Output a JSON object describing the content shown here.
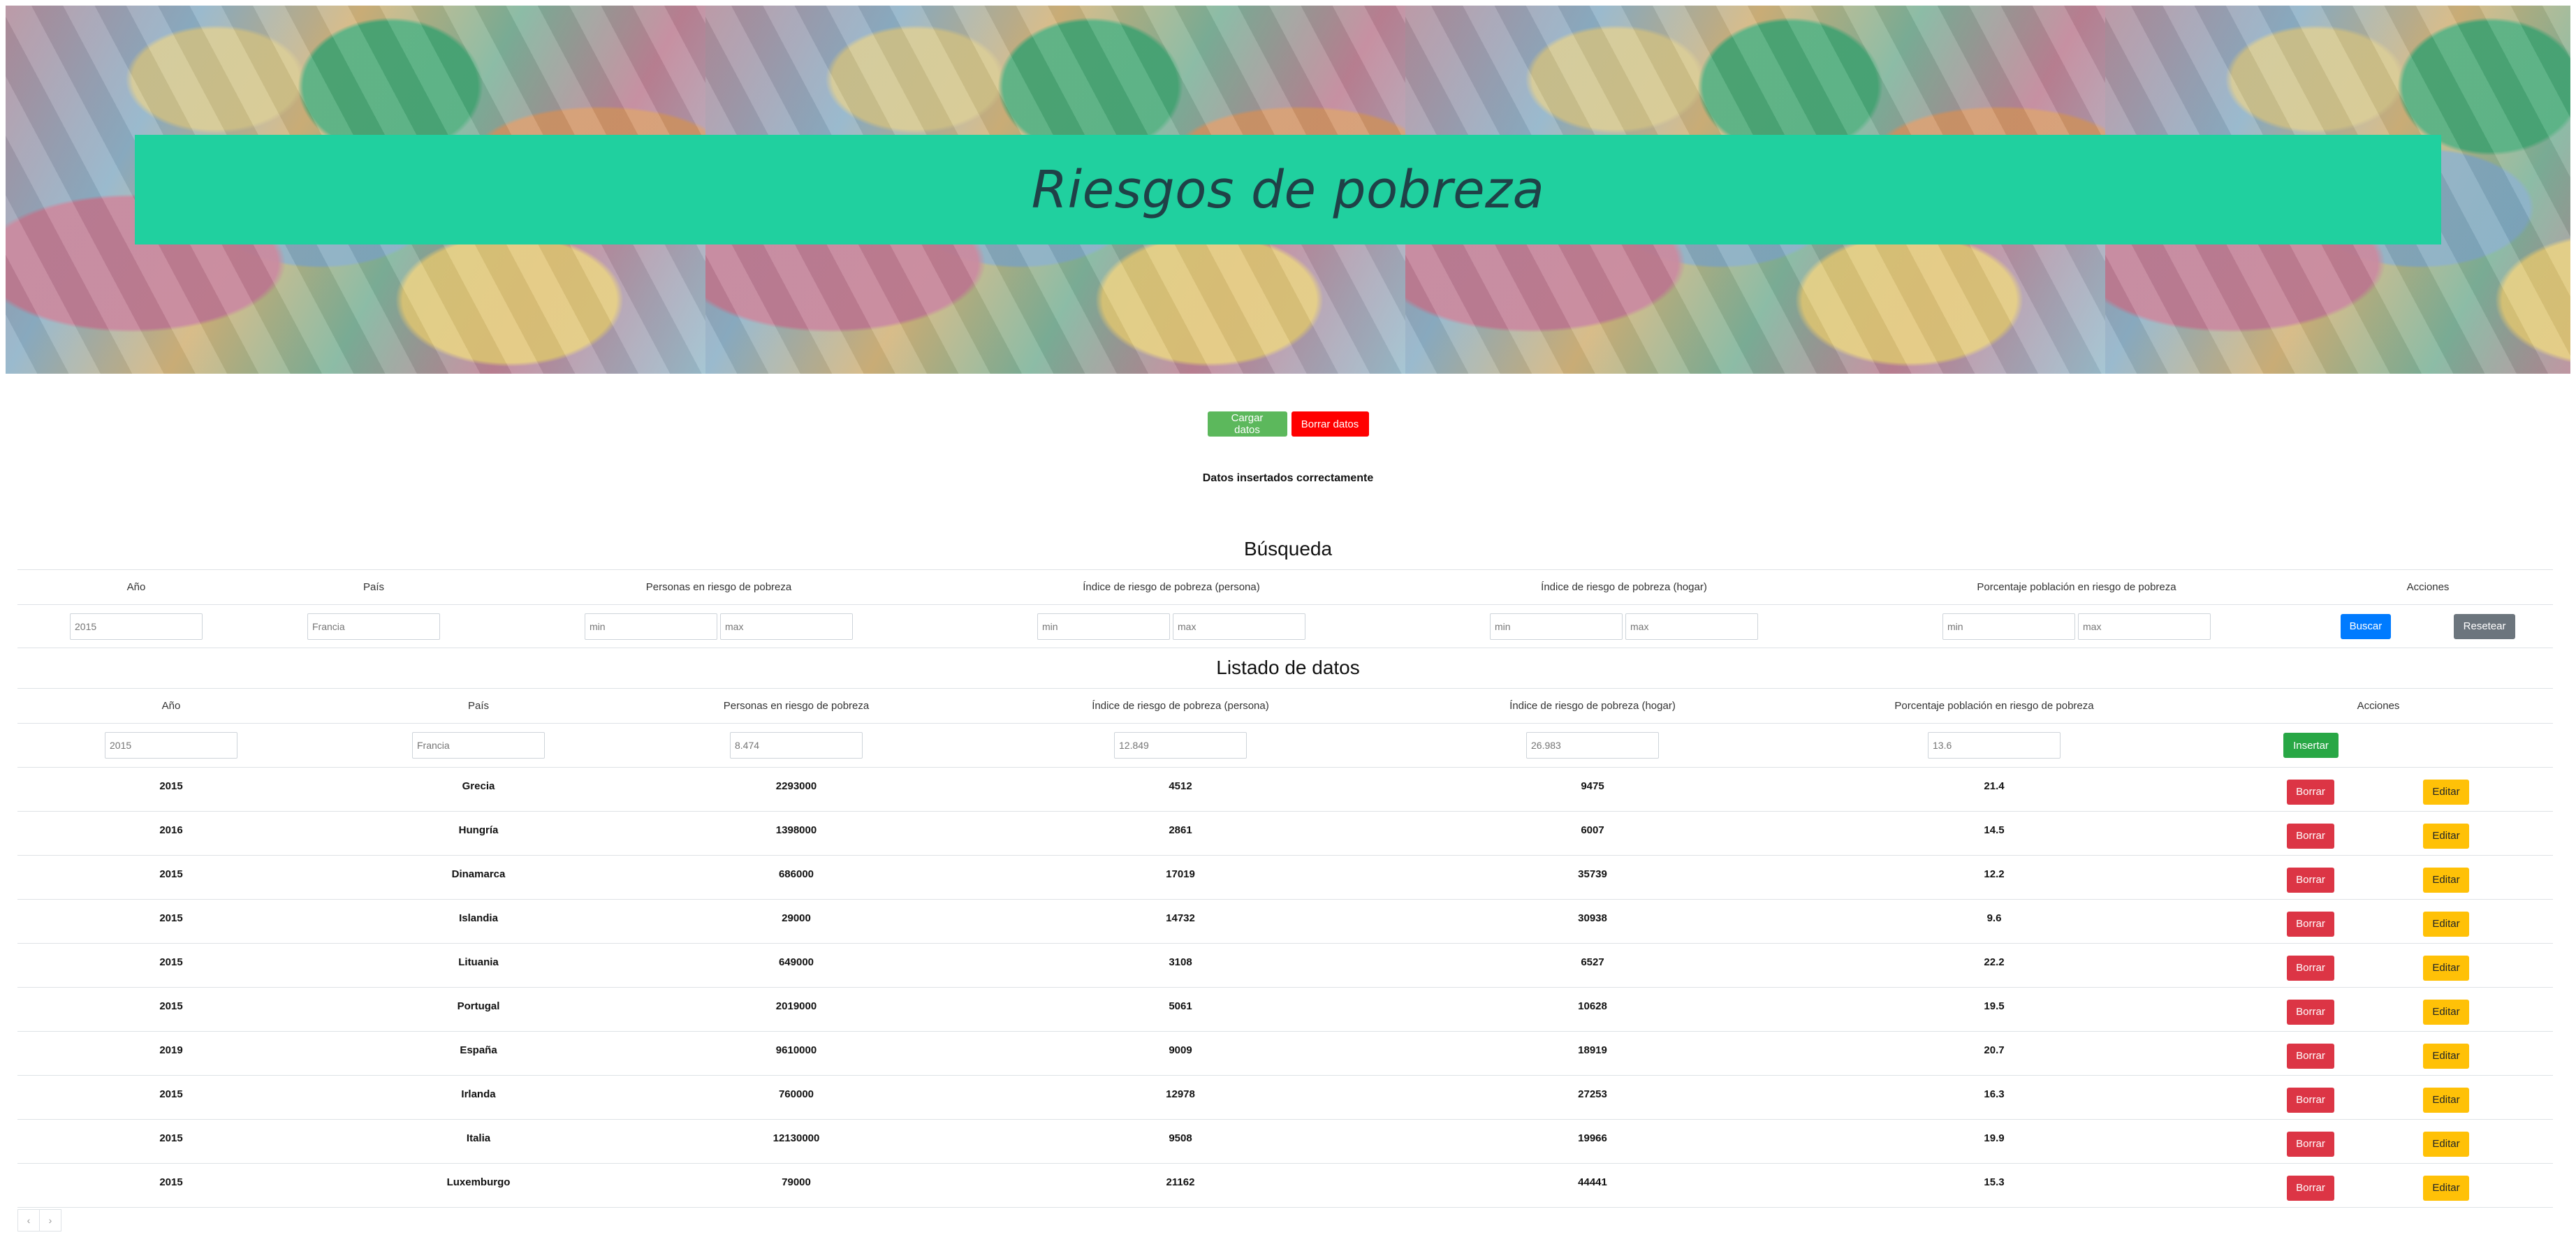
{
  "header": {
    "title": "Riesgos de pobreza"
  },
  "actions": {
    "load_label": "Cargar datos",
    "clear_label": "Borrar datos",
    "status_message": "Datos insertados correctamente"
  },
  "search": {
    "title": "Búsqueda",
    "columns": [
      "Año",
      "País",
      "Personas en riesgo de pobreza",
      "Índice de riesgo de pobreza (persona)",
      "Índice de riesgo de pobreza (hogar)",
      "Porcentaje población en riesgo de pobreza",
      "Acciones"
    ],
    "year_placeholder": "2015",
    "country_placeholder": "Francia",
    "min_placeholder": "min",
    "max_placeholder": "max",
    "search_label": "Buscar",
    "reset_label": "Resetear"
  },
  "list": {
    "title": "Listado de datos",
    "columns": [
      "Año",
      "País",
      "Personas en riesgo de pobreza",
      "Índice de riesgo de pobreza (persona)",
      "Índice de riesgo de pobreza (hogar)",
      "Porcentaje población en riesgo de pobreza",
      "Acciones"
    ],
    "new_row_placeholders": {
      "year": "2015",
      "country": "Francia",
      "people": "8.474",
      "index_person": "12.849",
      "index_home": "26.983",
      "percentage": "13.6"
    },
    "insert_label": "Insertar",
    "delete_label": "Borrar",
    "edit_label": "Editar",
    "rows": [
      [
        "2015",
        "Grecia",
        "2293000",
        "4512",
        "9475",
        "21.4"
      ],
      [
        "2016",
        "Hungría",
        "1398000",
        "2861",
        "6007",
        "14.5"
      ],
      [
        "2015",
        "Dinamarca",
        "686000",
        "17019",
        "35739",
        "12.2"
      ],
      [
        "2015",
        "Islandia",
        "29000",
        "14732",
        "30938",
        "9.6"
      ],
      [
        "2015",
        "Lituania",
        "649000",
        "3108",
        "6527",
        "22.2"
      ],
      [
        "2015",
        "Portugal",
        "2019000",
        "5061",
        "10628",
        "19.5"
      ],
      [
        "2019",
        "España",
        "9610000",
        "9009",
        "18919",
        "20.7"
      ],
      [
        "2015",
        "Irlanda",
        "760000",
        "12978",
        "27253",
        "16.3"
      ],
      [
        "2015",
        "Italia",
        "12130000",
        "9508",
        "19966",
        "19.9"
      ],
      [
        "2015",
        "Luxemburgo",
        "79000",
        "21162",
        "44441",
        "15.3"
      ]
    ]
  },
  "pagination": {
    "prev": "‹",
    "next": "›"
  }
}
